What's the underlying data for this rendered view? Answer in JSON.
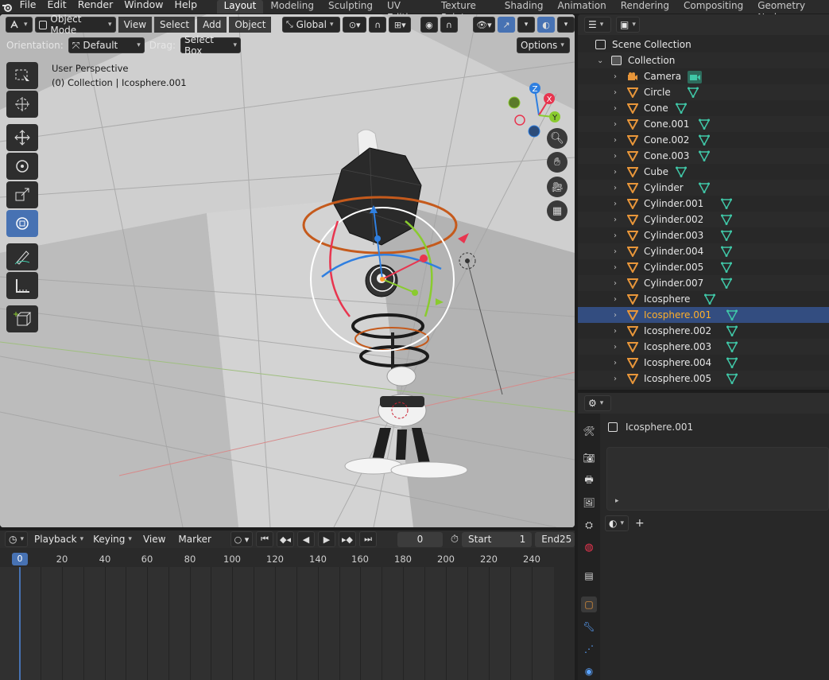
{
  "top_menu": {
    "items": [
      "File",
      "Edit",
      "Render",
      "Window",
      "Help"
    ],
    "workspaces": [
      "Layout",
      "Modeling",
      "Sculpting",
      "UV Editing",
      "Texture Paint",
      "Shading",
      "Animation",
      "Rendering",
      "Compositing",
      "Geometry Nodes"
    ],
    "active_workspace": "Layout"
  },
  "viewport": {
    "mode": "Object Mode",
    "menus": [
      "View",
      "Select",
      "Add",
      "Object"
    ],
    "transform_orientation": "Global",
    "orientation_label": "Orientation:",
    "orientation_value": "Default",
    "drag_label": "Drag:",
    "drag_value": "Select Box",
    "options_label": "Options",
    "overlay_line1": "User Perspective",
    "overlay_line2": "(0) Collection | Icosphere.001",
    "gizmo_axes": [
      "Z",
      "X",
      "Y"
    ]
  },
  "timeline": {
    "menus": [
      "Playback",
      "Keying",
      "View",
      "Marker"
    ],
    "current_frame": "0",
    "start_label": "Start",
    "start_value": "1",
    "end_label": "End",
    "end_value": "25",
    "ruler_ticks": [
      "20",
      "40",
      "60",
      "80",
      "100",
      "120",
      "140",
      "160",
      "180",
      "200",
      "220",
      "240"
    ],
    "cursor_frame": "0"
  },
  "outliner": {
    "root": "Scene Collection",
    "collection": "Collection",
    "objects": [
      {
        "name": "Camera",
        "type": "camera"
      },
      {
        "name": "Circle",
        "type": "mesh"
      },
      {
        "name": "Cone",
        "type": "mesh"
      },
      {
        "name": "Cone.001",
        "type": "mesh"
      },
      {
        "name": "Cone.002",
        "type": "mesh"
      },
      {
        "name": "Cone.003",
        "type": "mesh"
      },
      {
        "name": "Cube",
        "type": "mesh"
      },
      {
        "name": "Cylinder",
        "type": "mesh"
      },
      {
        "name": "Cylinder.001",
        "type": "mesh"
      },
      {
        "name": "Cylinder.002",
        "type": "mesh"
      },
      {
        "name": "Cylinder.003",
        "type": "mesh"
      },
      {
        "name": "Cylinder.004",
        "type": "mesh"
      },
      {
        "name": "Cylinder.005",
        "type": "mesh"
      },
      {
        "name": "Cylinder.007",
        "type": "mesh"
      },
      {
        "name": "Icosphere",
        "type": "mesh"
      },
      {
        "name": "Icosphere.001",
        "type": "mesh",
        "selected": true
      },
      {
        "name": "Icosphere.002",
        "type": "mesh"
      },
      {
        "name": "Icosphere.003",
        "type": "mesh"
      },
      {
        "name": "Icosphere.004",
        "type": "mesh"
      },
      {
        "name": "Icosphere.005",
        "type": "mesh"
      }
    ]
  },
  "properties": {
    "object_name": "Icosphere.001",
    "add_label": "+"
  },
  "colors": {
    "accent": "#4772b3",
    "selected_text": "#ffaf29",
    "mesh_icon": "#40c8a8",
    "object_icon": "#e8963a",
    "axis_x": "#e8354f",
    "axis_y": "#8acb2f",
    "axis_z": "#2f7fe0"
  }
}
